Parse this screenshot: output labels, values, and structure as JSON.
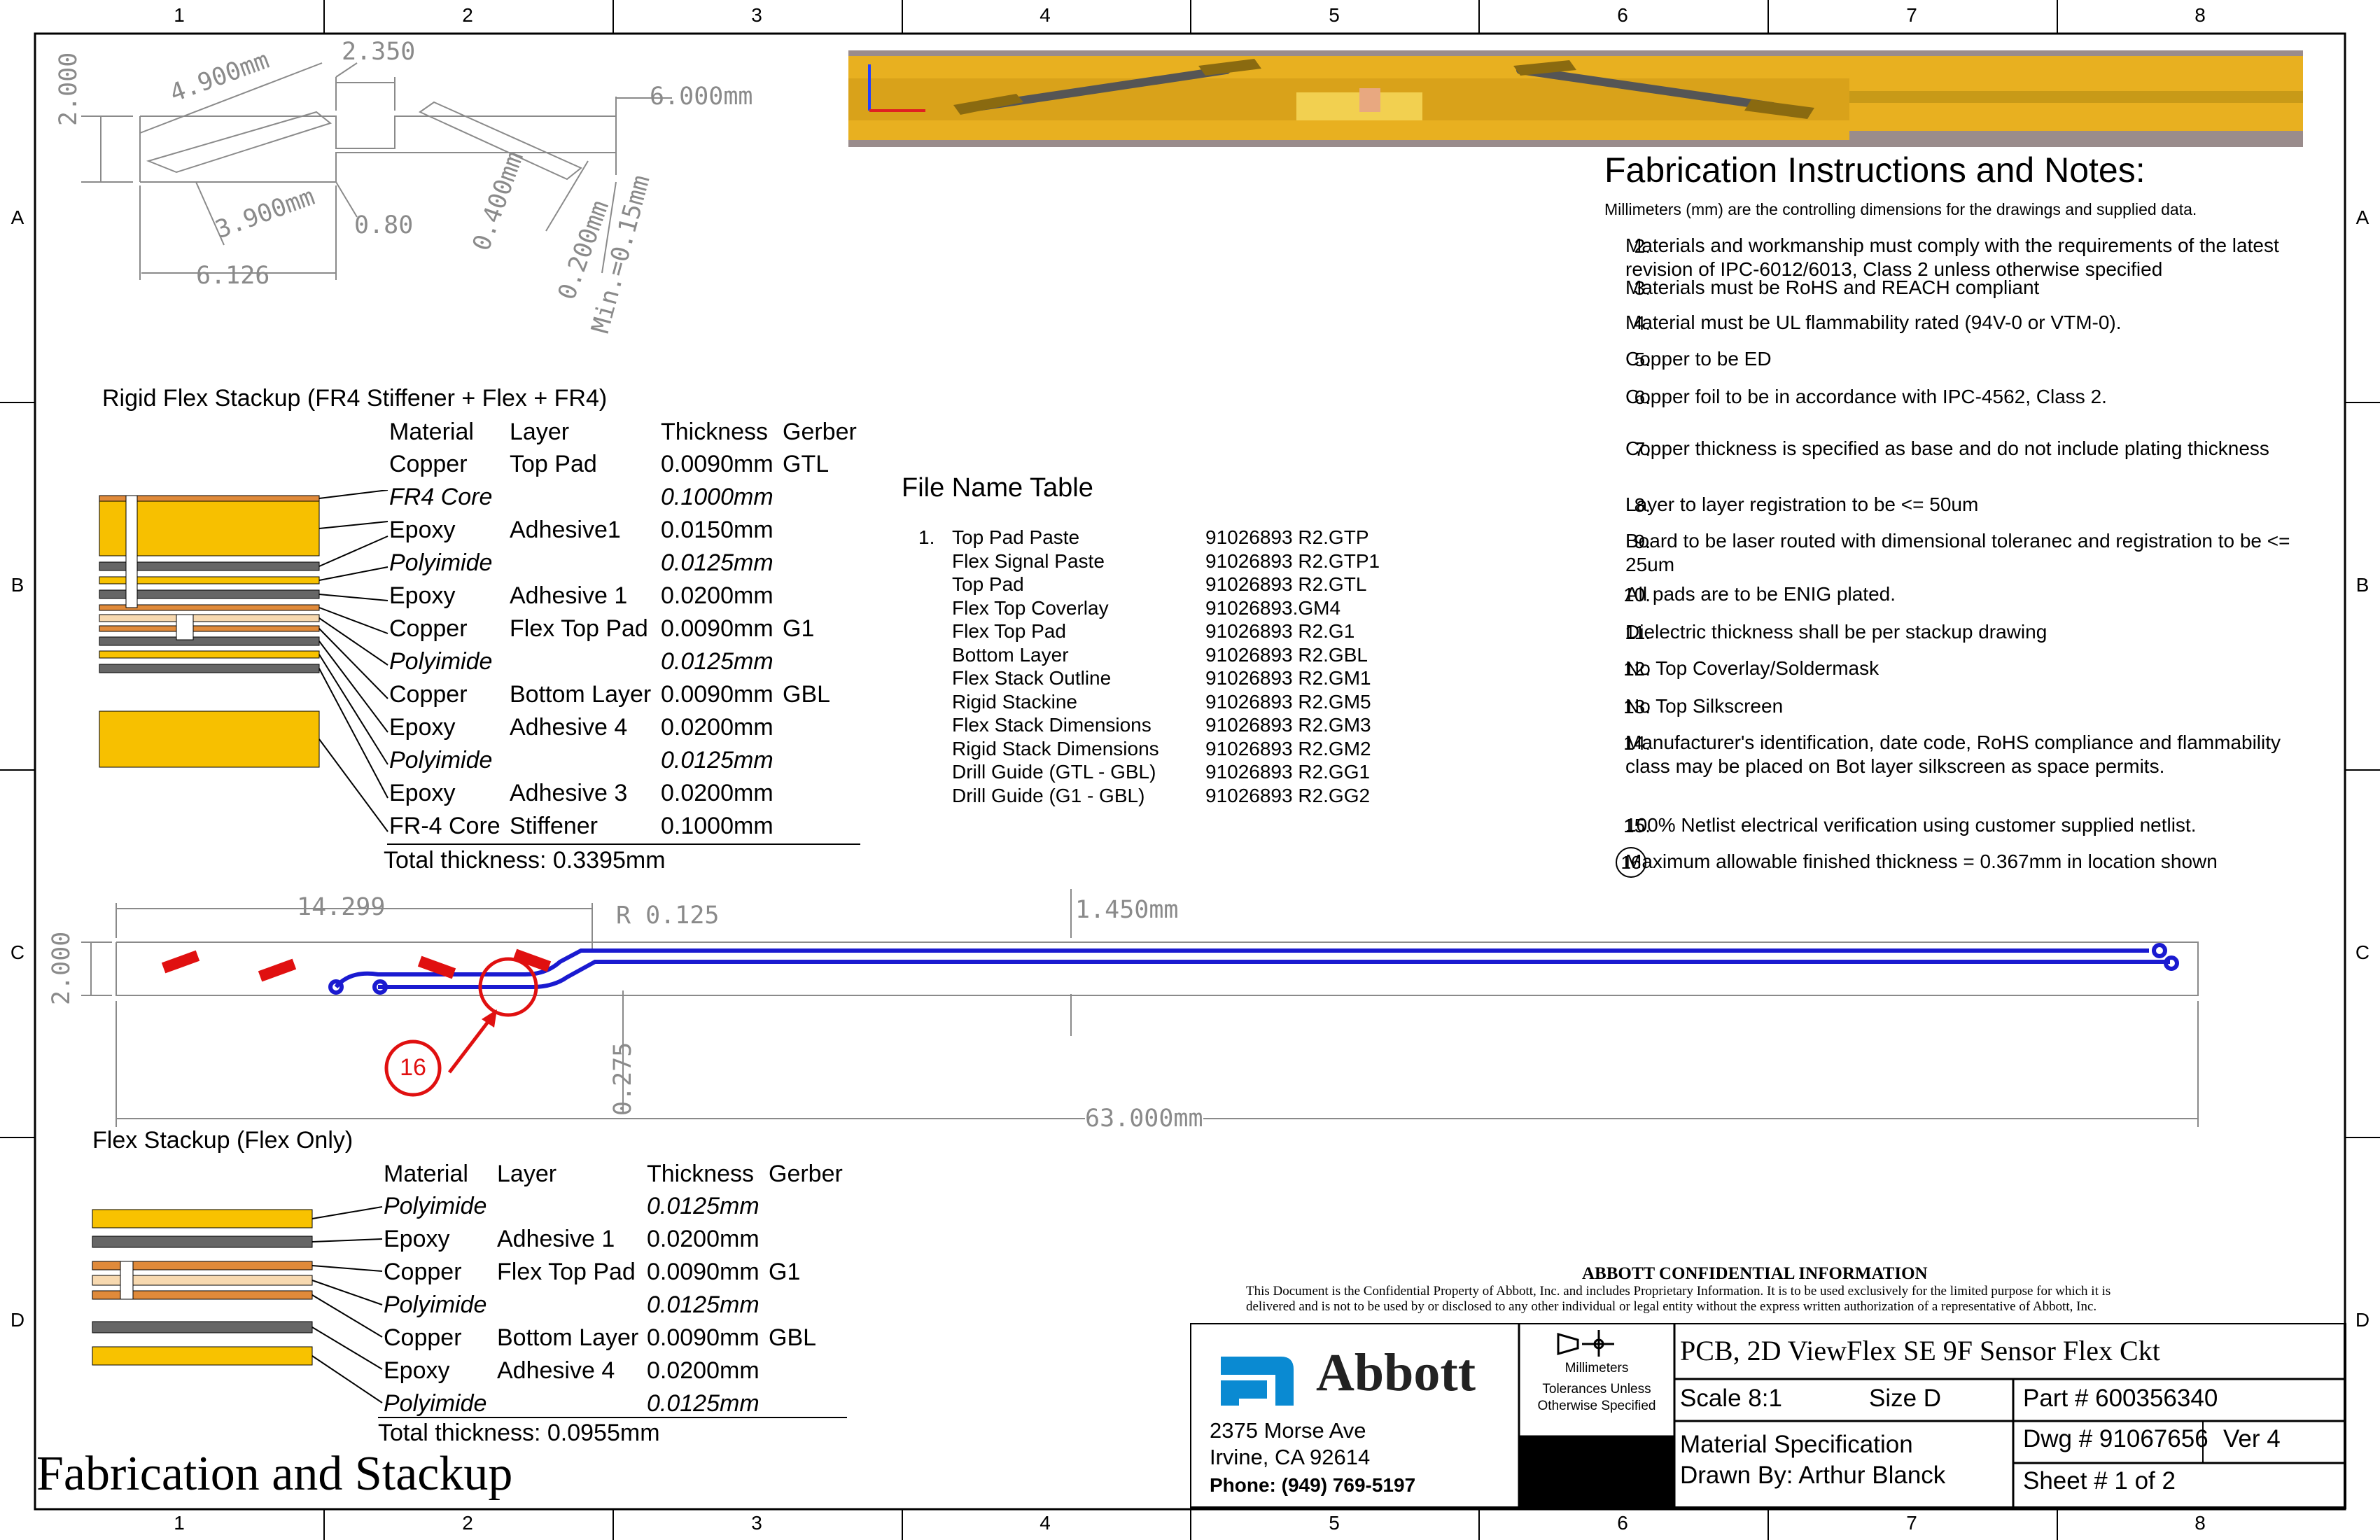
{
  "zones": {
    "columns": [
      "1",
      "2",
      "3",
      "4",
      "5",
      "6",
      "7",
      "8"
    ],
    "rows": [
      "A",
      "B",
      "C",
      "D"
    ]
  },
  "top_drawing": {
    "dims": [
      "4.900mm",
      "2.350",
      "6.000mm",
      "2.000",
      "3.900mm",
      "0.80",
      "6.126",
      "0.400mm",
      "0.200mm",
      "Min.=0.15mm"
    ]
  },
  "rigid_stackup": {
    "title": "Rigid Flex Stackup (FR4 Stiffener + Flex + FR4)",
    "headers": [
      "Material",
      "Layer",
      "Thickness",
      "Gerber"
    ],
    "rows": [
      {
        "material": "Copper",
        "layer": "Top Pad",
        "thickness": "0.0090mm",
        "gerber": "GTL",
        "italic": false
      },
      {
        "material": "FR4 Core",
        "layer": "",
        "thickness": "0.1000mm",
        "gerber": "",
        "italic": true
      },
      {
        "material": "Epoxy",
        "layer": "Adhesive1",
        "thickness": "0.0150mm",
        "gerber": "",
        "italic": false
      },
      {
        "material": "Polyimide",
        "layer": "",
        "thickness": "0.0125mm",
        "gerber": "",
        "italic": true
      },
      {
        "material": "Epoxy",
        "layer": "Adhesive 1",
        "thickness": "0.0200mm",
        "gerber": "",
        "italic": false
      },
      {
        "material": "Copper",
        "layer": "Flex Top Pad",
        "thickness": "0.0090mm",
        "gerber": "G1",
        "italic": false
      },
      {
        "material": "Polyimide",
        "layer": "",
        "thickness": "0.0125mm",
        "gerber": "",
        "italic": true
      },
      {
        "material": "Copper",
        "layer": "Bottom Layer",
        "thickness": "0.0090mm",
        "gerber": "GBL",
        "italic": false
      },
      {
        "material": "Epoxy",
        "layer": "Adhesive 4",
        "thickness": "0.0200mm",
        "gerber": "",
        "italic": false
      },
      {
        "material": "Polyimide",
        "layer": "",
        "thickness": "0.0125mm",
        "gerber": "",
        "italic": true
      },
      {
        "material": "Epoxy",
        "layer": "Adhesive 3",
        "thickness": "0.0200mm",
        "gerber": "",
        "italic": false
      },
      {
        "material": "FR-4 Core",
        "layer": "Stiffener",
        "thickness": "0.1000mm",
        "gerber": "",
        "italic": false
      }
    ],
    "total": "Total thickness: 0.3395mm"
  },
  "file_table": {
    "title": "File Name Table",
    "index_label": "1.",
    "rows": [
      {
        "name": "Top Pad Paste",
        "file": "91026893 R2.GTP"
      },
      {
        "name": "Flex Signal Paste",
        "file": "91026893 R2.GTP1"
      },
      {
        "name": "Top Pad",
        "file": "91026893 R2.GTL"
      },
      {
        "name": "Flex Top Coverlay",
        "file": "91026893.GM4"
      },
      {
        "name": "Flex Top Pad",
        "file": "91026893 R2.G1"
      },
      {
        "name": "Bottom Layer",
        "file": "91026893 R2.GBL"
      },
      {
        "name": "Flex Stack Outline",
        "file": "91026893 R2.GM1"
      },
      {
        "name": "Rigid Stackine",
        "file": "91026893 R2.GM5"
      },
      {
        "name": "Flex Stack Dimensions",
        "file": "91026893 R2.GM3"
      },
      {
        "name": "Rigid Stack Dimensions",
        "file": "91026893 R2.GM2"
      },
      {
        "name": "Drill Guide (GTL - GBL)",
        "file": "91026893 R2.GG1"
      },
      {
        "name": "Drill Guide (G1 - GBL)",
        "file": "91026893 R2.GG2"
      }
    ]
  },
  "notes": {
    "title": "Fabrication Instructions and Notes:",
    "intro": "Millimeters (mm) are the controlling dimensions for the drawings and supplied data.",
    "items": [
      {
        "num": "2.",
        "text": "Materials and workmanship must comply with the requirements of the latest revision of IPC-6012/6013, Class 2 unless otherwise specified"
      },
      {
        "num": "3.",
        "text": "Materials must be RoHS and REACH compliant"
      },
      {
        "num": "4.",
        "text": "Material must be UL flammability rated (94V-0 or VTM-0)."
      },
      {
        "num": "5.",
        "text": "Copper to be ED"
      },
      {
        "num": "6.",
        "text": "Copper foil to be in accordance with IPC-4562, Class 2."
      },
      {
        "num": "7.",
        "text": "Copper thickness is specified as base and do not include plating thickness"
      },
      {
        "num": "8.",
        "text": "Layer to layer registration to be <= 50um"
      },
      {
        "num": "9.",
        "text": "Board to be laser routed with dimensional toleranec and registration to be <= 25um"
      },
      {
        "num": "10.",
        "text": "All pads are to be ENIG plated."
      },
      {
        "num": "11.",
        "text": "Dielectric thickness shall be per stackup drawing"
      },
      {
        "num": "12.",
        "text": "No Top Coverlay/Soldermask"
      },
      {
        "num": "13.",
        "text": "No Top Silkscreen"
      },
      {
        "num": "14.",
        "text": "Manufacturer's identification, date code, RoHS compliance and flammability class may be placed on Bot layer silkscreen as space permits."
      },
      {
        "num": "15.",
        "text": "100%  Netlist electrical verification using customer supplied netlist."
      },
      {
        "num": "16",
        "text": "Maximum allowable finished thickness = 0.367mm in location shown"
      }
    ]
  },
  "flex_outline": {
    "dims": [
      "14.299",
      "R 0.125",
      "1.450mm",
      "2.000",
      "0.275",
      "63.000mm"
    ],
    "callout": "16"
  },
  "flex_stackup": {
    "title": "Flex Stackup (Flex Only)",
    "headers": [
      "Material",
      "Layer",
      "Thickness",
      "Gerber"
    ],
    "rows": [
      {
        "material": "Polyimide",
        "layer": "",
        "thickness": "0.0125mm",
        "gerber": "",
        "italic": true
      },
      {
        "material": "Epoxy",
        "layer": "Adhesive 1",
        "thickness": "0.0200mm",
        "gerber": "",
        "italic": false
      },
      {
        "material": "Copper",
        "layer": "Flex Top Pad",
        "thickness": "0.0090mm",
        "gerber": "G1",
        "italic": false
      },
      {
        "material": "Polyimide",
        "layer": "",
        "thickness": "0.0125mm",
        "gerber": "",
        "italic": true
      },
      {
        "material": "Copper",
        "layer": "Bottom Layer",
        "thickness": "0.0090mm",
        "gerber": "GBL",
        "italic": false
      },
      {
        "material": "Epoxy",
        "layer": "Adhesive 4",
        "thickness": "0.0200mm",
        "gerber": "",
        "italic": false
      },
      {
        "material": "Polyimide",
        "layer": "",
        "thickness": "0.0125mm",
        "gerber": "",
        "italic": true
      }
    ],
    "total": "Total thickness: 0.0955mm"
  },
  "sheet_title": "Fabrication and Stackup",
  "confidential": {
    "heading": "ABBOTT CONFIDENTIAL INFORMATION",
    "line1": "This Document is the Confidential Property of Abbott, Inc. and includes Proprietary Information. It is to be used exclusively for the limited purpose for which it is",
    "line2": "delivered and is not to be used by or disclosed to any other individual or legal entity without the express written authorization of a representative of Abbott, Inc."
  },
  "title_block": {
    "company": "Abbott",
    "address1": "2375 Morse Ave",
    "address2": "Irvine, CA 92614",
    "phone": "Phone: (949) 769-5197",
    "units": "Millimeters",
    "tolerance1": "Tolerances Unless",
    "tolerance2": "Otherwise Specified",
    "title": "PCB, 2D ViewFlex SE 9F Sensor Flex Ckt",
    "scale": "Scale 8:1",
    "size": "Size D",
    "part": "Part # 600356340",
    "spec": "Material Specification",
    "drawn": "Drawn By: Arthur Blanck",
    "dwg": "Dwg # 91067656",
    "ver": "Ver 4",
    "sheet": "Sheet # 1 of 2"
  },
  "colors": {
    "fr4": "#f7c000",
    "copper": "#e08a3a",
    "epoxy": "#666666",
    "polyimide": "#f8c200",
    "trace_blue": "#1a1ad0",
    "pad_red": "#e01010",
    "abbott_blue": "#0a8ad2"
  }
}
